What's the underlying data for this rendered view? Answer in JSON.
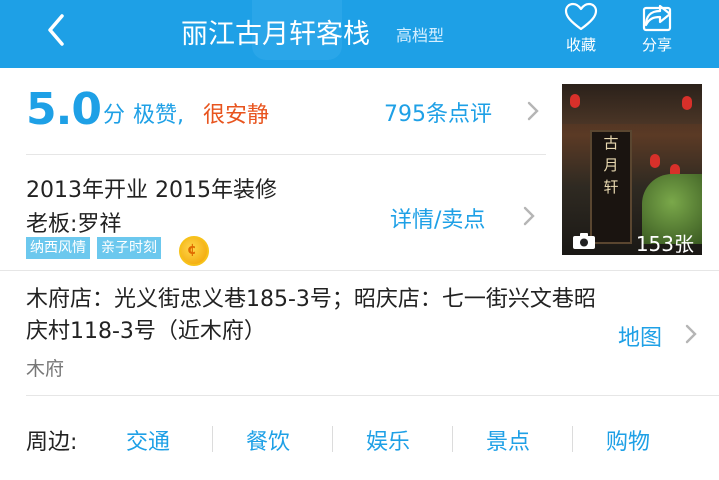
{
  "header": {
    "title": "丽江古月轩客栈",
    "grade": "高档型",
    "favorite_label": "收藏",
    "share_label": "分享",
    "bg_color": "#1ea0e6"
  },
  "rating": {
    "score": "5.0",
    "unit": "分",
    "summary": "极赞,",
    "highlight": "很安静",
    "reviews": "795条点评"
  },
  "info": {
    "open_renovate": "2013年开业 2015年装修",
    "owner": "老板:罗祥",
    "tags": [
      "纳西风情",
      "亲子时刻"
    ],
    "details_link": "详情/卖点"
  },
  "photo": {
    "sign_chars": [
      "古",
      "月",
      "轩"
    ],
    "count": "153张"
  },
  "location": {
    "address": "木府店：光义街忠义巷185-3号；昭庆店：七一街兴文巷昭庆村118-3号（近木府）",
    "area": "木府",
    "map_link": "地图"
  },
  "nearby": {
    "label": "周边:",
    "items": [
      "交通",
      "餐饮",
      "娱乐",
      "景点",
      "购物"
    ]
  },
  "colors": {
    "accent": "#1ea0e6",
    "highlight": "#e8541e",
    "tag_bg": "#6cc8ee"
  }
}
